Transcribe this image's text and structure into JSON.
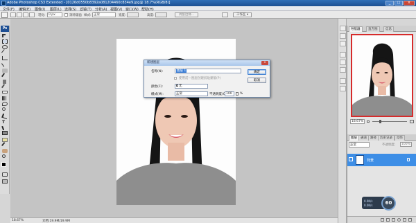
{
  "window": {
    "title": "Adobe Photoshop CS3 Extended - [0126d0550b8392a081204460c834e9.jpg@ 18.7%(RGB/8)]",
    "controls": [
      "_",
      "□",
      "×"
    ]
  },
  "menu": [
    "文件(F)",
    "编辑(E)",
    "图像(I)",
    "图层(L)",
    "选择(S)",
    "滤镜(T)",
    "分析(A)",
    "视图(V)",
    "窗口(W)",
    "帮助(H)"
  ],
  "options": {
    "feather_label": "羽化:",
    "feather_value": "0 px",
    "antialias_label": "消除锯齿",
    "style_label": "样式:",
    "style_value": "正常",
    "width_label": "宽度:",
    "height_label": "高度:",
    "refine_label": "调整边缘...",
    "workspace_label": "工作区 ▾"
  },
  "status": {
    "zoom": "18.67%",
    "doc": "文档:19.9M/19.9M"
  },
  "navigator": {
    "tabs": [
      "导航器",
      "直方图",
      "信息"
    ],
    "zoom_value": "18.67%"
  },
  "layers": {
    "tabs": [
      "图层",
      "通道",
      "路径",
      "历史记录",
      "动作"
    ],
    "blend_mode": "正常",
    "opacity_label": "不透明度:",
    "opacity_value": "100%",
    "lock_label": "锁定:",
    "fill_label": "填充:",
    "fill_value": "100%",
    "layer_name": "背景"
  },
  "dialog": {
    "title": "新建图层",
    "name_label": "名称(N):",
    "name_value": "图层 1",
    "clip_label": "使用前一图层创建剪贴蒙版(P)",
    "color_label": "颜色(C):",
    "color_value": "无",
    "mode_label": "模式(M):",
    "mode_value": "正常",
    "opacity_label": "不透明度(O):",
    "opacity_value": "100",
    "opacity_unit": "%",
    "ok": "确定",
    "cancel": "取消"
  },
  "overlay": {
    "badge": "60",
    "speed_up": "0.0K/s",
    "speed_down": "0.0K/s"
  },
  "colors": {
    "accent": "#3d8ee6",
    "title_bar": "#1c4f93",
    "nav_frame": "#d62b2b"
  }
}
